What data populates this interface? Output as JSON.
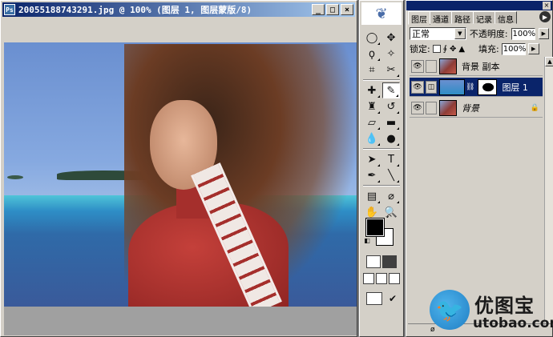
{
  "document": {
    "title": "20055188743291.jpg @ 100% (图层 1, 图层蒙版/8)",
    "minimize": "_",
    "maximize": "□",
    "close": "×"
  },
  "toolbox": {
    "tools": [
      {
        "name": "marquee",
        "glyph": "◯"
      },
      {
        "name": "move",
        "glyph": "✥"
      },
      {
        "name": "lasso",
        "glyph": "ϙ"
      },
      {
        "name": "magic-wand",
        "glyph": "✧"
      },
      {
        "name": "crop",
        "glyph": "⌗"
      },
      {
        "name": "slice",
        "glyph": "✂"
      },
      {
        "name": "healing",
        "glyph": "✚"
      },
      {
        "name": "brush",
        "glyph": "✎"
      },
      {
        "name": "stamp",
        "glyph": "♜"
      },
      {
        "name": "history-brush",
        "glyph": "↺"
      },
      {
        "name": "eraser",
        "glyph": "▱"
      },
      {
        "name": "gradient",
        "glyph": "▬"
      },
      {
        "name": "blur",
        "glyph": "💧"
      },
      {
        "name": "dodge",
        "glyph": "●"
      },
      {
        "name": "path-select",
        "glyph": "➤"
      },
      {
        "name": "type",
        "glyph": "T"
      },
      {
        "name": "pen",
        "glyph": "✒"
      },
      {
        "name": "line",
        "glyph": "╲"
      },
      {
        "name": "notes",
        "glyph": "▤"
      },
      {
        "name": "eyedropper",
        "glyph": "⌀"
      },
      {
        "name": "hand",
        "glyph": "✋"
      },
      {
        "name": "zoom",
        "glyph": "🔍"
      }
    ]
  },
  "layers_panel": {
    "tabs": [
      "图层",
      "通道",
      "路径",
      "记录",
      "信息"
    ],
    "blend_mode": "正常",
    "opacity_label": "不透明度:",
    "opacity_value": "100%",
    "lock_label": "锁定:",
    "fill_label": "填充:",
    "fill_value": "100%",
    "layers": [
      {
        "name": "背景 副本",
        "selected": false,
        "italic": false
      },
      {
        "name": "图层 1",
        "selected": true,
        "italic": false
      },
      {
        "name": "背景",
        "selected": false,
        "italic": true
      }
    ]
  },
  "watermark": {
    "cn": "优图宝",
    "en": "utobao.com"
  },
  "colors": {
    "title_active": "#0a246a",
    "panel_bg": "#d4d0c8",
    "selection": "#0a246a"
  }
}
